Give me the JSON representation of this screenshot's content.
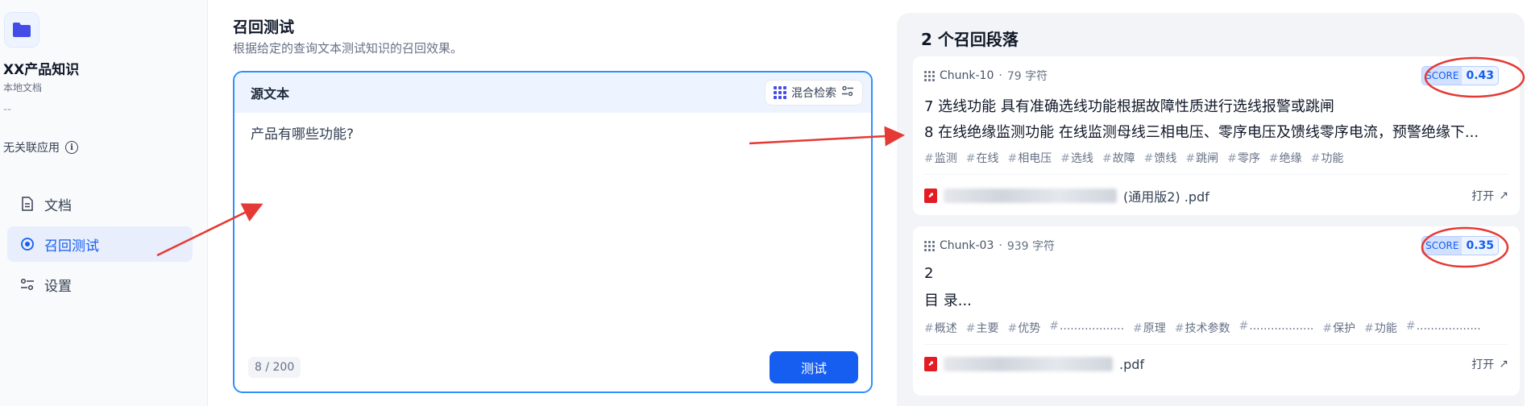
{
  "sidebar": {
    "kb_name": "XX产品知识",
    "kb_type": "本地文档",
    "dash": "--",
    "no_app": "无关联应用",
    "nav": [
      {
        "label": "文档",
        "icon": "document-icon",
        "active": false
      },
      {
        "label": "召回测试",
        "icon": "target-icon",
        "active": true
      },
      {
        "label": "设置",
        "icon": "sliders-icon",
        "active": false
      }
    ]
  },
  "main": {
    "title": "召回测试",
    "description": "根据给定的查询文本测试知识的召回效果。",
    "source_label": "源文本",
    "retrieval_mode": "混合检索",
    "query": "产品有哪些功能?",
    "char_count": "8 / 200",
    "test_button": "测试"
  },
  "results": {
    "title": "2 个召回段落",
    "chunks": [
      {
        "id": "Chunk-10",
        "chars": "79 字符",
        "score_label": "SCORE",
        "score": "0.43",
        "lines": [
          "7 选线功能 具有准确选线功能根据故障性质进行选线报警或跳闸",
          "8 在线绝缘监测功能 在线监测母线三相电压、零序电压及馈线零序电流，预警绝缘下..."
        ],
        "keywords": [
          "监测",
          "在线",
          "相电压",
          "选线",
          "故障",
          "馈线",
          "跳闸",
          "零序",
          "绝缘",
          "功能"
        ],
        "file_name": "(通用版2) .pdf",
        "open": "打开"
      },
      {
        "id": "Chunk-03",
        "chars": "939 字符",
        "score_label": "SCORE",
        "score": "0.35",
        "lines": [
          "2",
          "目 录..."
        ],
        "keywords": [
          "概述",
          "主要",
          "优势",
          "..................",
          "原理",
          "技术参数",
          "..................",
          "保护",
          "功能",
          ".................."
        ],
        "file_name": ".pdf",
        "open": "打开"
      }
    ]
  },
  "colors": {
    "accent": "#155eef",
    "annotation": "#e53935"
  }
}
